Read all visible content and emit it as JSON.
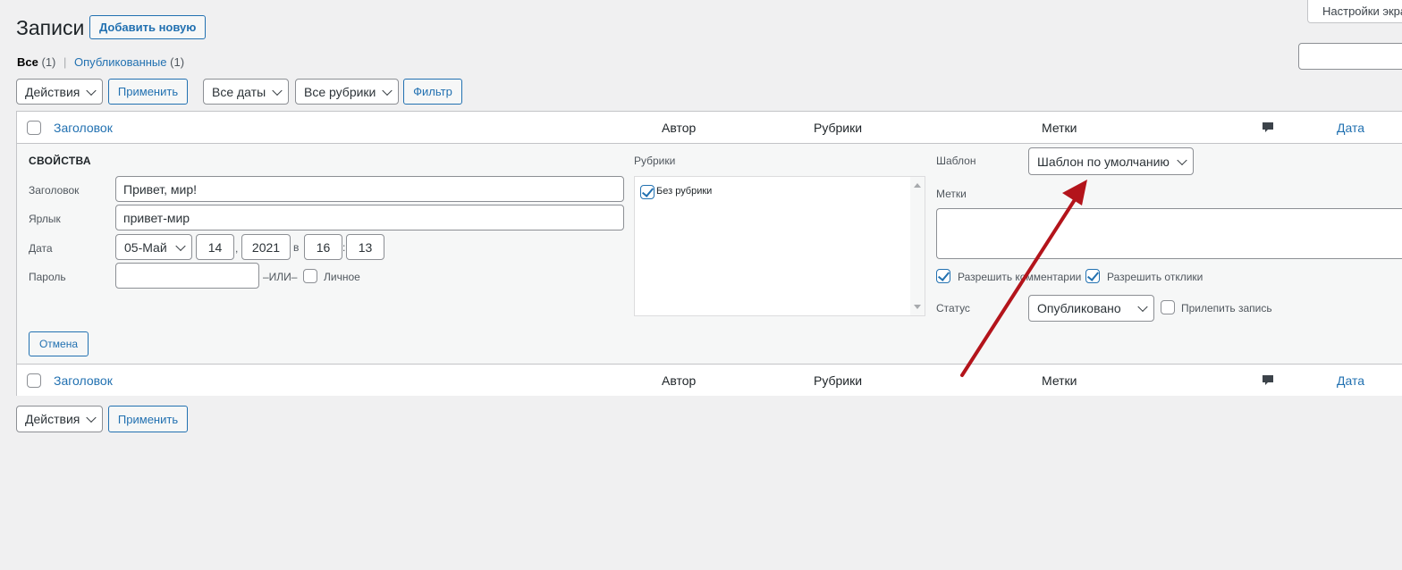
{
  "header": {
    "title": "Записи",
    "add_new": "Добавить новую",
    "screen_options": "Настройки экра"
  },
  "views": {
    "all_label": "Все",
    "all_count": "(1)",
    "separator": "|",
    "published_label": "Опубликованные",
    "published_count": "(1)"
  },
  "top_actions": {
    "bulk_action": "Действия",
    "apply": "Применить",
    "dates": "Все даты",
    "categories": "Все рубрики",
    "filter": "Фильтр"
  },
  "columns": {
    "title": "Заголовок",
    "author": "Автор",
    "categories": "Рубрики",
    "tags": "Метки",
    "comments_icon": "comment-icon",
    "date": "Дата"
  },
  "quick_edit": {
    "heading": "СВОЙСТВА",
    "title_label": "Заголовок",
    "title_value": "Привет, мир!",
    "slug_label": "Ярлык",
    "slug_value": "привет-мир",
    "date_label": "Дата",
    "month": "05-Май",
    "day": "14",
    "comma": ",",
    "year": "2021",
    "at": "в",
    "hour": "16",
    "colon": ":",
    "minute": "13",
    "password_label": "Пароль",
    "password_value": "",
    "or_label": "–ИЛИ–",
    "private_label": "Личное",
    "categories_label": "Рубрики",
    "category_item": "Без рубрики",
    "template_label": "Шаблон",
    "template_value": "Шаблон по умолчанию",
    "tags_label": "Метки",
    "allow_comments": "Разрешить комментарии",
    "allow_pings": "Разрешить отклики",
    "status_label": "Статус",
    "status_value": "Опубликовано",
    "sticky_label": "Прилепить запись",
    "cancel": "Отмена"
  },
  "bottom_actions": {
    "bulk_action": "Действия",
    "apply": "Применить"
  },
  "colors": {
    "accent": "#2271b1",
    "annotation_arrow": "#b3141b"
  }
}
